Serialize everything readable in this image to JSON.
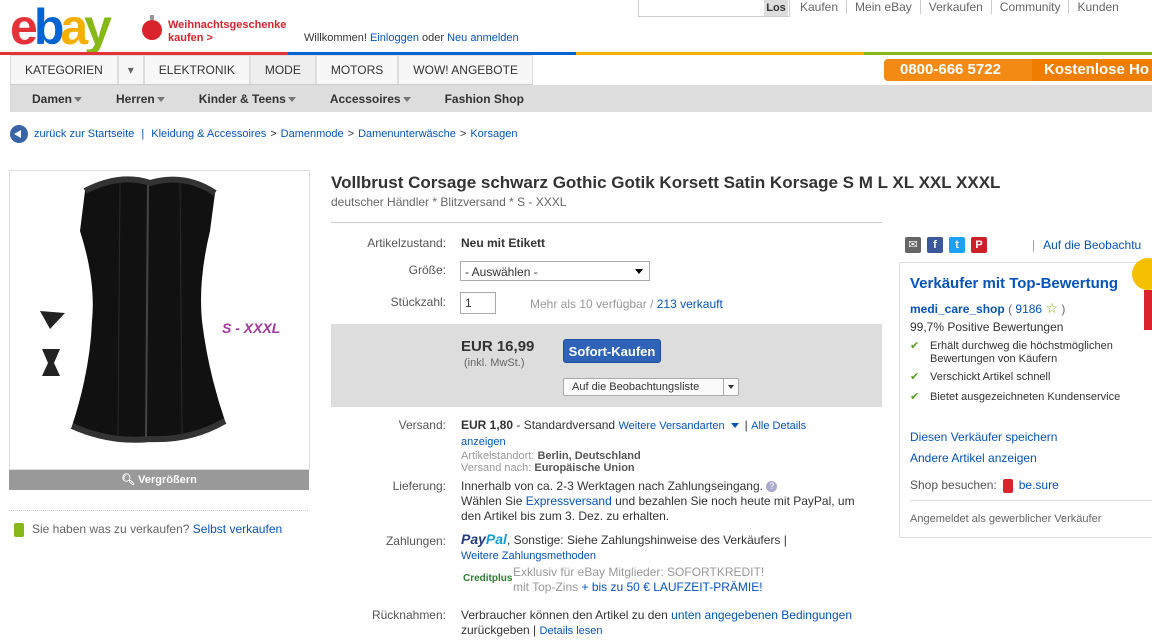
{
  "header": {
    "logo": {
      "e": "e",
      "b": "b",
      "a": "a",
      "y": "y"
    },
    "xmas_line1": "Weihnachtsgeschenke",
    "xmas_line2": "kaufen >",
    "welcome_prefix": "Willkommen!",
    "login": "Einloggen",
    "oder": "oder",
    "register": "Neu anmelden",
    "search_button": "Los",
    "top_links": [
      "Kaufen",
      "Mein eBay",
      "Verkaufen",
      "Community",
      "Kunden"
    ]
  },
  "nav": {
    "tabs": [
      "KATEGORIEN",
      "ELEKTRONIK",
      "MODE",
      "MOTORS",
      "WOW! ANGEBOTE"
    ],
    "phone": "0800-666 5722",
    "phone_free": "Kostenlose Ho",
    "subnav": [
      "Damen",
      "Herren",
      "Kinder & Teens",
      "Accessoires",
      "Fashion Shop"
    ]
  },
  "breadcrumb": {
    "back": "zurück zur Startseite",
    "items": [
      "Kleidung & Accessoires",
      "Damenmode",
      "Damenunterwäsche",
      "Korsagen"
    ]
  },
  "image": {
    "size_label": "S - XXXL",
    "enlarge": "Vergrößern"
  },
  "sell": {
    "question": "Sie haben was zu verkaufen?",
    "link": "Selbst verkaufen"
  },
  "item": {
    "title": "Vollbrust Corsage schwarz Gothic Gotik Korsett Satin Korsage S M L XL XXL XXXL",
    "subtitle": "deutscher Händler * Blitzversand * S - XXXL",
    "condition_label": "Artikelzustand:",
    "condition": "Neu mit Etikett",
    "size_label": "Größe:",
    "size_value": "- Auswählen -",
    "qty_label": "Stückzahl:",
    "qty_value": "1",
    "availability": "Mehr als 10 verfügbar",
    "sold": "213 verkauft",
    "price": "EUR 16,99",
    "vat": "(inkl. MwSt.)",
    "buy": "Sofort-Kaufen",
    "watch": "Auf die Beobachtungsliste"
  },
  "shipping": {
    "label": "Versand:",
    "cost": "EUR 1,80",
    "method": "- Standardversand",
    "more": "Weitere Versandarten",
    "details_a": "Alle Details",
    "details_b": "anzeigen",
    "location_label": "Artikelstandort:",
    "location": "Berlin, Deutschland",
    "ships_to_label": "Versand nach:",
    "ships_to": "Europäische Union"
  },
  "delivery": {
    "label": "Lieferung:",
    "line1": "Innerhalb von ca. 2-3 Werktagen nach Zahlungseingang.",
    "line2a": "Wählen Sie",
    "express": "Expressversand",
    "line2b": "und bezahlen Sie noch heute mit PayPal, um",
    "line3": "den Artikel bis zum 3. Dez. zu erhalten."
  },
  "payment": {
    "label": "Zahlungen:",
    "paypal1": "Pay",
    "paypal2": "Pal",
    "other": ", Sonstige: Siehe Zahlungshinweise des Verkäufers |",
    "more": "Weitere Zahlungsmethoden",
    "creditplus": "Creditplus",
    "credit1": "Exklusiv für eBay Mitglieder: SOFORTKREDIT!",
    "credit2a": "mit Top-Zins",
    "credit2b": "+ bis zu 50 € LAUFZEIT-PRÄMIE!"
  },
  "returns": {
    "label": "Rücknahmen:",
    "text": "Verbraucher können den Artikel zu den",
    "link": "unten angegebenen Bedingungen",
    "text2": "zurückgeben |",
    "details": "Details lesen"
  },
  "social": {
    "mail": "✉",
    "fb": "f",
    "tw": "t",
    "pin": "P",
    "watch_link": "Auf die Beobachtu"
  },
  "seller": {
    "heading": "Verkäufer mit Top-Bewertung",
    "name": "medi_care_shop",
    "score": "9186",
    "positive": "99,7% Positive Bewertungen",
    "checks": [
      [
        "Erhält durchweg die höchstmöglichen",
        "Bewertungen von Käufern"
      ],
      [
        "Verschickt Artikel schnell"
      ],
      [
        "Bietet ausgezeichneten Kundenservice"
      ]
    ],
    "save": "Diesen Verkäufer speichern",
    "other": "Andere Artikel anzeigen",
    "shop_label": "Shop besuchen:",
    "shop": "be.sure",
    "commercial": "Angemeldet als gewerblicher Verkäufer"
  },
  "colors": {
    "accent": "#0654ba",
    "buy": "#2e63b8",
    "phone": "#f28a14"
  }
}
